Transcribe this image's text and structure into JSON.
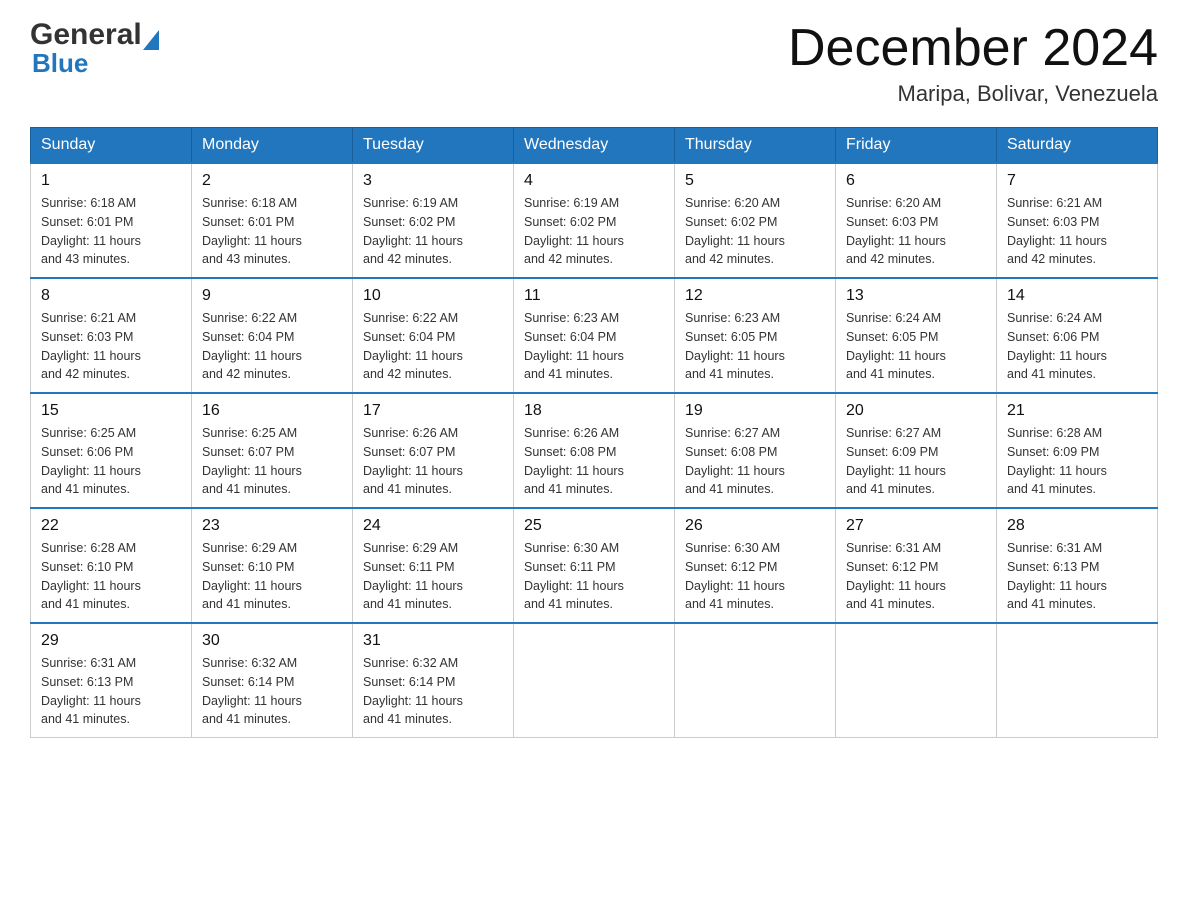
{
  "header": {
    "logo_general": "General",
    "logo_blue": "Blue",
    "month_title": "December 2024",
    "location": "Maripa, Bolivar, Venezuela"
  },
  "days_of_week": [
    "Sunday",
    "Monday",
    "Tuesday",
    "Wednesday",
    "Thursday",
    "Friday",
    "Saturday"
  ],
  "weeks": [
    [
      {
        "day": "1",
        "sunrise": "6:18 AM",
        "sunset": "6:01 PM",
        "daylight": "11 hours and 43 minutes."
      },
      {
        "day": "2",
        "sunrise": "6:18 AM",
        "sunset": "6:01 PM",
        "daylight": "11 hours and 43 minutes."
      },
      {
        "day": "3",
        "sunrise": "6:19 AM",
        "sunset": "6:02 PM",
        "daylight": "11 hours and 42 minutes."
      },
      {
        "day": "4",
        "sunrise": "6:19 AM",
        "sunset": "6:02 PM",
        "daylight": "11 hours and 42 minutes."
      },
      {
        "day": "5",
        "sunrise": "6:20 AM",
        "sunset": "6:02 PM",
        "daylight": "11 hours and 42 minutes."
      },
      {
        "day": "6",
        "sunrise": "6:20 AM",
        "sunset": "6:03 PM",
        "daylight": "11 hours and 42 minutes."
      },
      {
        "day": "7",
        "sunrise": "6:21 AM",
        "sunset": "6:03 PM",
        "daylight": "11 hours and 42 minutes."
      }
    ],
    [
      {
        "day": "8",
        "sunrise": "6:21 AM",
        "sunset": "6:03 PM",
        "daylight": "11 hours and 42 minutes."
      },
      {
        "day": "9",
        "sunrise": "6:22 AM",
        "sunset": "6:04 PM",
        "daylight": "11 hours and 42 minutes."
      },
      {
        "day": "10",
        "sunrise": "6:22 AM",
        "sunset": "6:04 PM",
        "daylight": "11 hours and 42 minutes."
      },
      {
        "day": "11",
        "sunrise": "6:23 AM",
        "sunset": "6:04 PM",
        "daylight": "11 hours and 41 minutes."
      },
      {
        "day": "12",
        "sunrise": "6:23 AM",
        "sunset": "6:05 PM",
        "daylight": "11 hours and 41 minutes."
      },
      {
        "day": "13",
        "sunrise": "6:24 AM",
        "sunset": "6:05 PM",
        "daylight": "11 hours and 41 minutes."
      },
      {
        "day": "14",
        "sunrise": "6:24 AM",
        "sunset": "6:06 PM",
        "daylight": "11 hours and 41 minutes."
      }
    ],
    [
      {
        "day": "15",
        "sunrise": "6:25 AM",
        "sunset": "6:06 PM",
        "daylight": "11 hours and 41 minutes."
      },
      {
        "day": "16",
        "sunrise": "6:25 AM",
        "sunset": "6:07 PM",
        "daylight": "11 hours and 41 minutes."
      },
      {
        "day": "17",
        "sunrise": "6:26 AM",
        "sunset": "6:07 PM",
        "daylight": "11 hours and 41 minutes."
      },
      {
        "day": "18",
        "sunrise": "6:26 AM",
        "sunset": "6:08 PM",
        "daylight": "11 hours and 41 minutes."
      },
      {
        "day": "19",
        "sunrise": "6:27 AM",
        "sunset": "6:08 PM",
        "daylight": "11 hours and 41 minutes."
      },
      {
        "day": "20",
        "sunrise": "6:27 AM",
        "sunset": "6:09 PM",
        "daylight": "11 hours and 41 minutes."
      },
      {
        "day": "21",
        "sunrise": "6:28 AM",
        "sunset": "6:09 PM",
        "daylight": "11 hours and 41 minutes."
      }
    ],
    [
      {
        "day": "22",
        "sunrise": "6:28 AM",
        "sunset": "6:10 PM",
        "daylight": "11 hours and 41 minutes."
      },
      {
        "day": "23",
        "sunrise": "6:29 AM",
        "sunset": "6:10 PM",
        "daylight": "11 hours and 41 minutes."
      },
      {
        "day": "24",
        "sunrise": "6:29 AM",
        "sunset": "6:11 PM",
        "daylight": "11 hours and 41 minutes."
      },
      {
        "day": "25",
        "sunrise": "6:30 AM",
        "sunset": "6:11 PM",
        "daylight": "11 hours and 41 minutes."
      },
      {
        "day": "26",
        "sunrise": "6:30 AM",
        "sunset": "6:12 PM",
        "daylight": "11 hours and 41 minutes."
      },
      {
        "day": "27",
        "sunrise": "6:31 AM",
        "sunset": "6:12 PM",
        "daylight": "11 hours and 41 minutes."
      },
      {
        "day": "28",
        "sunrise": "6:31 AM",
        "sunset": "6:13 PM",
        "daylight": "11 hours and 41 minutes."
      }
    ],
    [
      {
        "day": "29",
        "sunrise": "6:31 AM",
        "sunset": "6:13 PM",
        "daylight": "11 hours and 41 minutes."
      },
      {
        "day": "30",
        "sunrise": "6:32 AM",
        "sunset": "6:14 PM",
        "daylight": "11 hours and 41 minutes."
      },
      {
        "day": "31",
        "sunrise": "6:32 AM",
        "sunset": "6:14 PM",
        "daylight": "11 hours and 41 minutes."
      },
      null,
      null,
      null,
      null
    ]
  ],
  "labels": {
    "sunrise": "Sunrise:",
    "sunset": "Sunset:",
    "daylight": "Daylight:"
  }
}
